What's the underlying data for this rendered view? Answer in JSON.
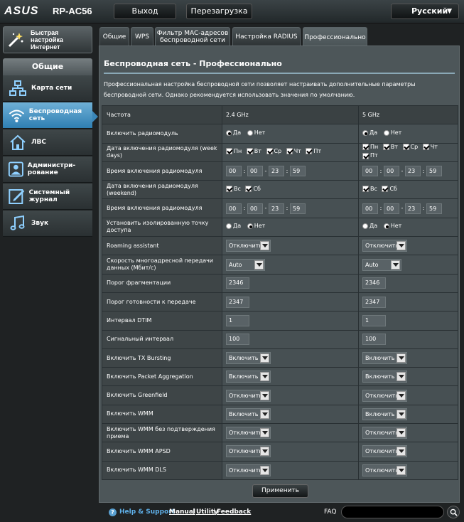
{
  "header": {
    "brand": "ASUS",
    "model": "RP-AC56",
    "logout_label": "Выход",
    "reboot_label": "Перезагрузка",
    "language": "Русский"
  },
  "sidebar": {
    "quick_setup": "Быстрая настройка Интернет",
    "section_title": "Общие",
    "items": [
      {
        "label": "Карта сети",
        "icon": "network-map-icon"
      },
      {
        "label": "Беспроводная сеть",
        "icon": "wireless-icon"
      },
      {
        "label": "ЛВС",
        "icon": "home-icon"
      },
      {
        "label": "Администри-рование",
        "icon": "admin-user-icon"
      },
      {
        "label": "Системный журнал",
        "icon": "syslog-icon"
      },
      {
        "label": "Звук",
        "icon": "music-note-icon"
      }
    ]
  },
  "tabs": [
    {
      "label": "Общие"
    },
    {
      "label": "WPS"
    },
    {
      "label": "Фильтр MAC-адресов беспроводной сети"
    },
    {
      "label": "Настройка RADIUS"
    },
    {
      "label": "Профессионально"
    }
  ],
  "panel": {
    "title": "Беспроводная сеть - Профессионально",
    "description": "Профессиональная настройка беспроводной сети позволяет настраивать дополнительные параметры беспроводной сети. Однако рекомендуется использовать значения по умолчанию."
  },
  "table": {
    "header": {
      "label": "Частота",
      "band1": "2.4 GHz",
      "band2": "5 GHz"
    },
    "radio_enable": {
      "label": "Включить радиомодуль",
      "yes": "Да",
      "no": "Нет"
    },
    "weekdays": {
      "label": "Дата включения радиомодуля (week days)",
      "days": [
        "Пн",
        "Вт",
        "Ср",
        "Чт",
        "Пт"
      ]
    },
    "weekday_time": {
      "label": "Время включения радиомодуля",
      "values": [
        "00",
        "00",
        "23",
        "59"
      ]
    },
    "weekend": {
      "label": "Дата включения радиомодуля (weekend)",
      "days": [
        "Вс",
        "Сб"
      ]
    },
    "weekend_time": {
      "label": "Время включения радиомодуля",
      "values": [
        "00",
        "00",
        "23",
        "59"
      ]
    },
    "ap_isolated": {
      "label": "Установить изолированную точку доступа",
      "yes": "Да",
      "no": "Нет"
    },
    "roaming": {
      "label": "Roaming assistant",
      "band1": "Отключить",
      "band2": "Отключить"
    },
    "multicast": {
      "label": "Скорость многоадресной передачи данных (Мбит/с)",
      "band1": "Auto",
      "band2": "Auto"
    },
    "frag": {
      "label": "Порог фрагментации",
      "band1": "2346",
      "band2": "2346"
    },
    "rts": {
      "label": "Порог готовности к передаче",
      "band1": "2347",
      "band2": "2347"
    },
    "dtim": {
      "label": "Интервал DTIM",
      "band1": "1",
      "band2": "1"
    },
    "beacon": {
      "label": "Сигнальный интервал",
      "band1": "100",
      "band2": "100"
    },
    "tx_bursting": {
      "label": "Включить TX Bursting",
      "band1": "Включить",
      "band2": "Включить"
    },
    "packet_agg": {
      "label": "Включить Packet Aggregation",
      "band1": "Включить",
      "band2": "Включить"
    },
    "greenfield": {
      "label": "Включить Greenfield",
      "band1": "Отключить",
      "band2": "Отключить"
    },
    "wmm": {
      "label": "Включить WMM",
      "band1": "Включить",
      "band2": "Включить"
    },
    "wmm_noack": {
      "label": "Включить WMM без подтверждения приема",
      "band1": "Отключить",
      "band2": "Отключить"
    },
    "wmm_apsd": {
      "label": "Включить WMM APSD",
      "band1": "Отключить",
      "band2": "Отключить"
    },
    "wmm_dls": {
      "label": "Включить WMM DLS",
      "band1": "Отключить",
      "band2": "Отключить"
    }
  },
  "apply_label": "Применить",
  "footer": {
    "help": "Help & Support",
    "manual": "Manual",
    "utility": "Utility",
    "feedback": "Feedback",
    "separator": "|",
    "faq": "FAQ"
  }
}
